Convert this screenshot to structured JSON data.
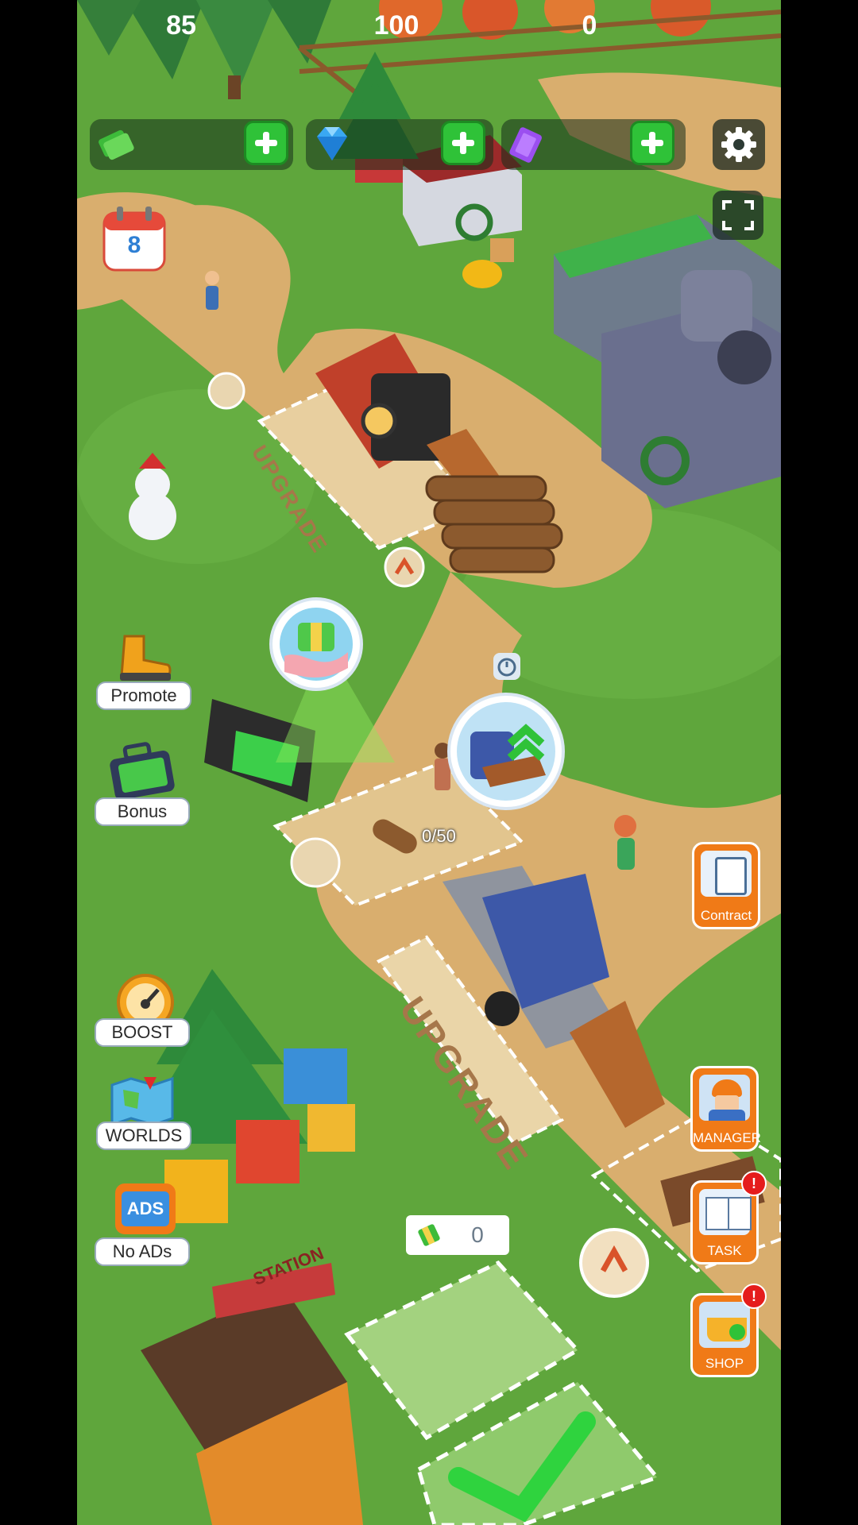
{
  "currency": {
    "cash": {
      "icon": "cash-stack-icon",
      "value": "85"
    },
    "gems": {
      "icon": "diamond-icon",
      "value": "100"
    },
    "tickets": {
      "icon": "purple-ticket-icon",
      "value": "0"
    }
  },
  "calendar": {
    "icon": "calendar-icon",
    "day": "8"
  },
  "side_left": {
    "promote": {
      "label": "Promote",
      "icon": "boot-icon"
    },
    "bonus": {
      "label": "Bonus",
      "icon": "cash-briefcase-icon"
    },
    "boost": {
      "label": "BOOST",
      "icon": "speedometer-icon"
    },
    "worlds": {
      "label": "WORLDS",
      "icon": "world-map-icon"
    },
    "no_ads": {
      "label": "No ADs",
      "icon_text": "ADS"
    }
  },
  "side_right": {
    "contract": {
      "label": "Contract",
      "icon": "clipboard-icon"
    },
    "manager": {
      "label": "MANAGER",
      "icon": "manager-worker-icon"
    },
    "task": {
      "label": "TASK",
      "icon": "task-book-icon",
      "badge": "!"
    },
    "shop": {
      "label": "SHOP",
      "icon": "shop-basket-icon",
      "badge": "!"
    }
  },
  "world": {
    "upgrade_zone_1": "UPGRADE",
    "upgrade_zone_2": "UPGRADE",
    "log_counter": "0/50",
    "build_cost": "0",
    "station_sign": "STATION"
  },
  "colors": {
    "grass": "#5fa63c",
    "path": "#d9ae6e",
    "accent_green": "#2fc238",
    "accent_orange": "#f07a17"
  }
}
